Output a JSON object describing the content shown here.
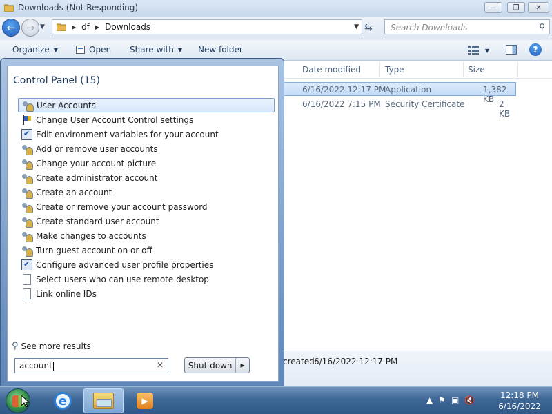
{
  "window": {
    "title": "Downloads (Not Responding)",
    "buttons": {
      "minimize": "—",
      "maximize": "❐",
      "close": "✕"
    }
  },
  "address_bar": {
    "breadcrumbs": [
      "df",
      "Downloads"
    ],
    "search_placeholder": "Search Downloads"
  },
  "toolbar": {
    "organize": "Organize",
    "open": "Open",
    "share_with": "Share with",
    "new_folder": "New folder"
  },
  "file_list": {
    "columns": [
      "Date modified",
      "Type",
      "Size"
    ],
    "rows": [
      {
        "date": "6/16/2022 12:17 PM",
        "type": "Application",
        "size": "1,382 KB",
        "selected": true
      },
      {
        "date": "6/16/2022 7:15 PM",
        "type": "Security Certificate",
        "size": "2 KB",
        "selected": false
      }
    ]
  },
  "details_pane": {
    "created_label": "created:",
    "created_value": "6/16/2022 12:17 PM"
  },
  "start_menu": {
    "group_heading": "Control Panel (15)",
    "results": [
      {
        "label": "User Accounts",
        "icon": "users-icon",
        "highlighted": true
      },
      {
        "label": "Change User Account Control settings",
        "icon": "flag-icon"
      },
      {
        "label": "Edit environment variables for your account",
        "icon": "system-icon"
      },
      {
        "label": "Add or remove user accounts",
        "icon": "users-icon"
      },
      {
        "label": "Change your account picture",
        "icon": "users-icon"
      },
      {
        "label": "Create administrator account",
        "icon": "users-icon"
      },
      {
        "label": "Create an account",
        "icon": "users-icon"
      },
      {
        "label": "Create or remove your account password",
        "icon": "users-icon"
      },
      {
        "label": "Create standard user account",
        "icon": "users-icon"
      },
      {
        "label": "Make changes to accounts",
        "icon": "users-icon"
      },
      {
        "label": "Turn guest account on or off",
        "icon": "users-icon"
      },
      {
        "label": "Configure advanced user profile properties",
        "icon": "system-icon"
      },
      {
        "label": "Select users who can use remote desktop",
        "icon": "document-icon"
      },
      {
        "label": "Link online IDs",
        "icon": "document-icon"
      }
    ],
    "see_more": "See more results",
    "search_value": "account",
    "clear_glyph": "✕",
    "shutdown_label": "Shut down"
  },
  "taskbar": {
    "clock_time": "12:18 PM",
    "clock_date": "6/16/2022"
  }
}
